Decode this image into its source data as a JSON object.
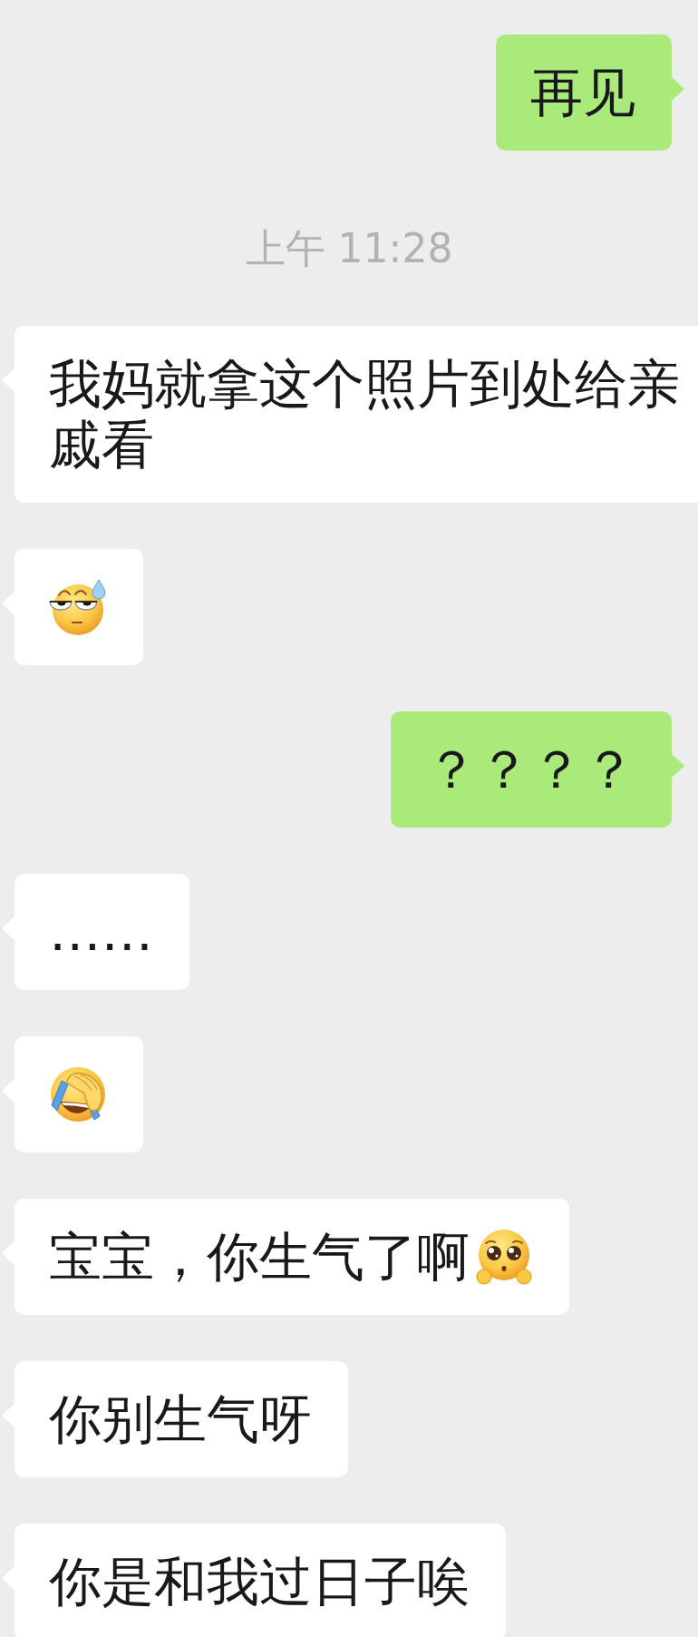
{
  "chat": [
    {
      "kind": "bubble",
      "outgoing": true,
      "parts": [
        {
          "kind": "text",
          "text": "再见"
        }
      ]
    },
    {
      "kind": "time",
      "text": "上午 11:28"
    },
    {
      "kind": "bubble",
      "outgoing": false,
      "parts": [
        {
          "kind": "text",
          "text": "我妈就拿这个照片到处给亲戚看"
        }
      ]
    },
    {
      "kind": "bubble",
      "outgoing": false,
      "parts": [
        {
          "kind": "sweat"
        }
      ]
    },
    {
      "kind": "bubble",
      "outgoing": true,
      "parts": [
        {
          "kind": "text",
          "text": "？？？？"
        }
      ]
    },
    {
      "kind": "bubble",
      "outgoing": false,
      "parts": [
        {
          "kind": "text",
          "text": "……"
        }
      ]
    },
    {
      "kind": "bubble",
      "outgoing": false,
      "parts": [
        {
          "kind": "facepalm"
        }
      ]
    },
    {
      "kind": "bubble",
      "outgoing": false,
      "parts": [
        {
          "kind": "text",
          "text": "宝宝，你生气了啊"
        },
        {
          "kind": "pleading"
        }
      ]
    },
    {
      "kind": "bubble",
      "outgoing": false,
      "parts": [
        {
          "kind": "text",
          "text": "你别生气呀"
        }
      ]
    },
    {
      "kind": "bubble",
      "outgoing": false,
      "parts": [
        {
          "kind": "text",
          "text": "你是和我过日子唉"
        }
      ]
    }
  ]
}
